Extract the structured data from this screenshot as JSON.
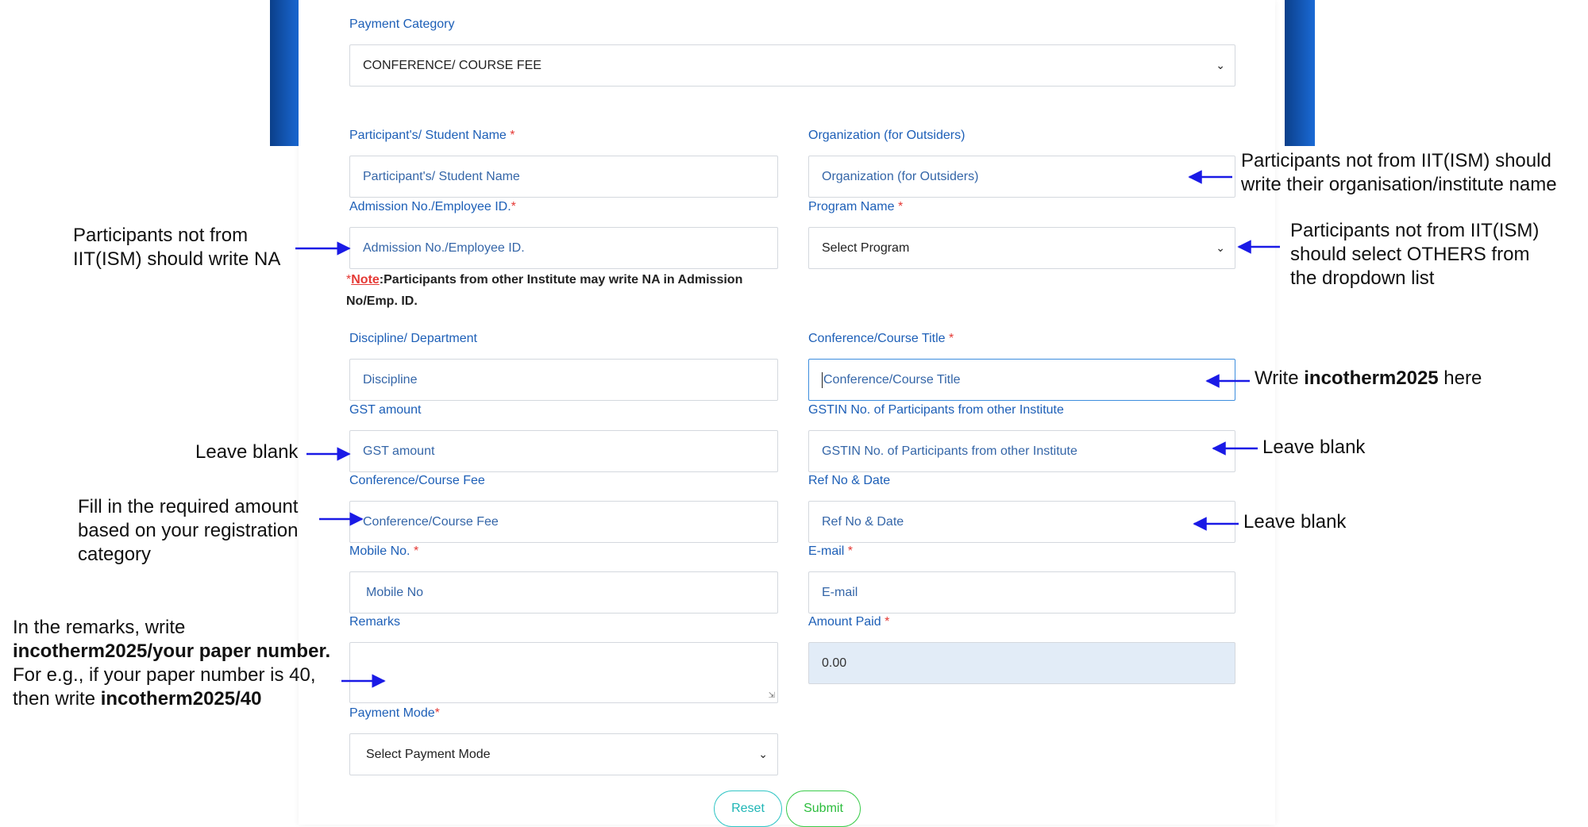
{
  "form": {
    "payment_category": {
      "label": "Payment Category",
      "value": "CONFERENCE/ COURSE FEE"
    },
    "student_name": {
      "label": "Participant's/ Student Name",
      "placeholder": "Participant's/ Student Name"
    },
    "organization": {
      "label": "Organization (for Outsiders)",
      "placeholder": "Organization (for Outsiders)"
    },
    "admission_no": {
      "label": "Admission No./Employee ID.",
      "placeholder": "Admission No./Employee ID."
    },
    "program_name": {
      "label": "Program Name",
      "value": "Select Program"
    },
    "note": {
      "star": "*",
      "prefix": "Note",
      "text": ":Participants from other Institute may write NA in Admission No/Emp. ID."
    },
    "discipline": {
      "label": "Discipline/ Department",
      "placeholder": "Discipline"
    },
    "course_title": {
      "label": "Conference/Course Title",
      "placeholder": "Conference/Course Title"
    },
    "gst_amount": {
      "label": "GST amount",
      "placeholder": "GST amount"
    },
    "gstin": {
      "label": "GSTIN No. of Participants from other Institute",
      "placeholder": "GSTIN No. of Participants from other Institute"
    },
    "course_fee": {
      "label": "Conference/Course Fee",
      "placeholder": "Conference/Course Fee"
    },
    "ref_no": {
      "label": "Ref No & Date",
      "placeholder": "Ref No & Date"
    },
    "mobile": {
      "label": "Mobile No.",
      "placeholder": "Mobile No"
    },
    "email": {
      "label": "E-mail",
      "placeholder": "E-mail"
    },
    "remarks": {
      "label": "Remarks",
      "placeholder": ""
    },
    "amount_paid": {
      "label": "Amount Paid",
      "value": "0.00"
    },
    "payment_mode": {
      "label": "Payment Mode",
      "value": "Select Payment Mode"
    },
    "required_marker": "*",
    "buttons": {
      "reset": "Reset",
      "submit": "Submit"
    }
  },
  "annotations": {
    "organisation": [
      "Participants not from IIT(ISM) should",
      "write their organisation/institute name"
    ],
    "admission_na": [
      "Participants not from",
      "IIT(ISM) should write NA"
    ],
    "program_others": [
      "Participants not from IIT(ISM)",
      "should select OTHERS from",
      "the dropdown list"
    ],
    "title_write": {
      "pre": "Write ",
      "bold": "incotherm2025",
      "post": " here"
    },
    "gst_blank": "Leave blank",
    "gstin_blank": "Leave blank",
    "ref_blank": "Leave blank",
    "fee_fill": [
      "Fill in the required amount",
      "based on your registration",
      "category"
    ],
    "remarks": {
      "line1": "In the remarks, write",
      "line2_bold": "incotherm2025/your paper number.",
      "line3": "For e.g., if your paper number is 40,",
      "line4_pre": "then write ",
      "line4_bold": "incotherm2025/40"
    }
  },
  "colors": {
    "label_blue": "#1d5fb7",
    "arrow_blue": "#1a1ae6",
    "required_red": "#e53935",
    "band_blue": "#1a6ad6"
  }
}
